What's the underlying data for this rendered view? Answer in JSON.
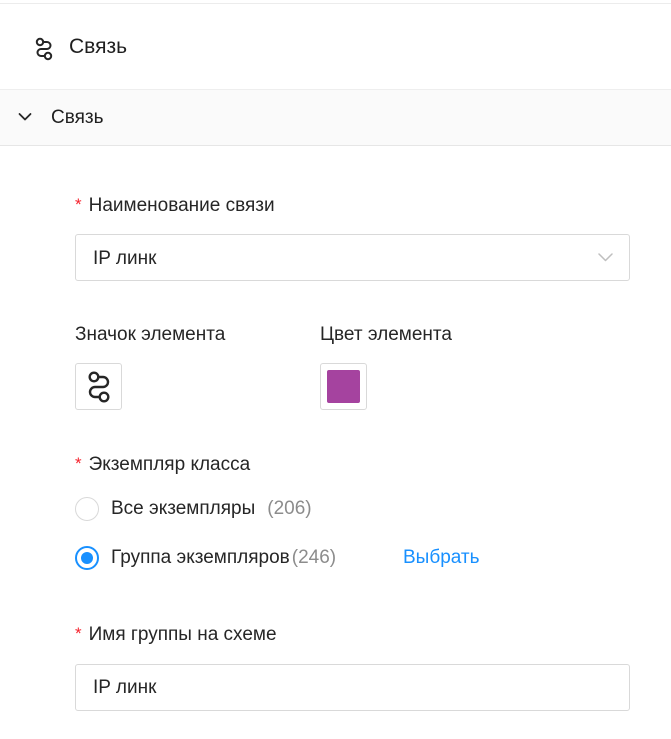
{
  "panel": {
    "title": "Связь",
    "title_icon": "link-path-icon"
  },
  "section": {
    "title": "Связь",
    "expanded": true,
    "toggle_icon": "chevron-down-icon"
  },
  "link_name": {
    "label": "Наименование связи",
    "required": true,
    "value": "IP линк",
    "dropdown_icon": "chevron-down-icon"
  },
  "element_icon": {
    "label": "Значок элемента",
    "icon": "link-path-icon"
  },
  "element_color": {
    "label": "Цвет элемента",
    "color": "#a5439f"
  },
  "class_instance": {
    "label": "Экземпляр класса",
    "required": true,
    "options": [
      {
        "label": "Все экземпляры",
        "count": "(206)",
        "checked": false
      },
      {
        "label": "Группа экземпляров",
        "count": "(246)",
        "checked": true
      }
    ],
    "choose_link": "Выбрать"
  },
  "group_name": {
    "label": "Имя группы на схеме",
    "required": true,
    "value": "IP линк"
  },
  "colors": {
    "accent": "#1890ff",
    "required_mark": "#f5222d"
  }
}
